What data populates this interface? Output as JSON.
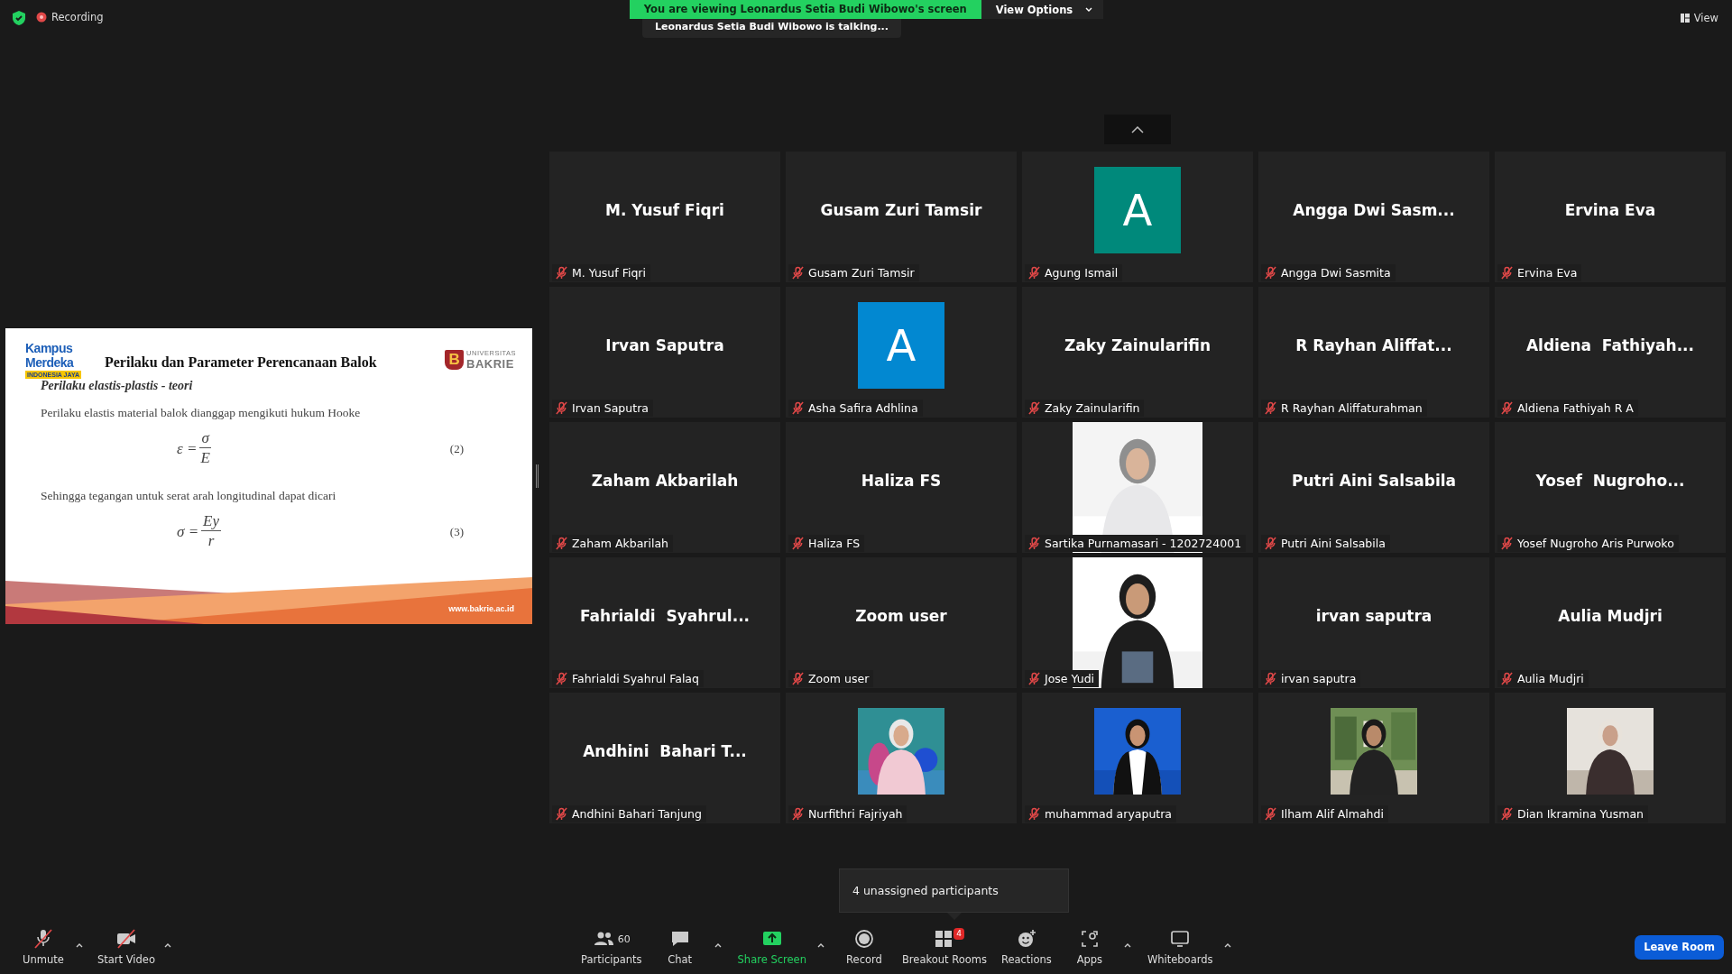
{
  "top_bar": {
    "recording": "Recording",
    "banner": "You are viewing Leonardus Setia Budi Wibowo's screen",
    "view_options": "View Options",
    "talking": "Leonardus Setia Budi Wibowo is talking...",
    "view": "View"
  },
  "slide": {
    "logo_left": {
      "line1": "Kampus",
      "line2": "Merdeka",
      "tag": "INDONESIA JAYA"
    },
    "title": "Perilaku dan Parameter Perencanaan Balok",
    "logo_right": {
      "mark": "B",
      "small": "UNIVERSITAS",
      "name": "BAKRIE"
    },
    "subtitle": "Perilaku elastis-plastis - teori",
    "body": [
      {
        "kind": "paragraph",
        "text": "Perilaku elastis material balok dianggap mengikuti hukum Hooke"
      },
      {
        "kind": "equation",
        "lhs": "ε =",
        "numerator": "σ",
        "denominator": "E",
        "number": "(2)"
      },
      {
        "kind": "paragraph",
        "text": "Sehingga tegangan untuk serat arah longitudinal dapat dicari"
      },
      {
        "kind": "equation",
        "lhs": "σ =",
        "numerator": "Ey",
        "denominator": "r",
        "number": "(3)"
      }
    ],
    "footer": "www.bakrie.ac.id"
  },
  "tiles": [
    {
      "kind": "name",
      "display": "M. Yusuf Fiqri",
      "label": "M. Yusuf Fiqri",
      "muted": true
    },
    {
      "kind": "name",
      "display": "Gusam Zuri Tamsir",
      "label": "Gusam Zuri Tamsir",
      "muted": true
    },
    {
      "kind": "avatar",
      "letter": "A",
      "color": "#00897b",
      "label": "Agung Ismail",
      "muted": true
    },
    {
      "kind": "name",
      "display": "Angga Dwi Sasm...",
      "label": "Angga Dwi Sasmita",
      "muted": true
    },
    {
      "kind": "name",
      "display": "Ervina Eva",
      "label": "Ervina Eva",
      "muted": true
    },
    {
      "kind": "name",
      "display": "Irvan Saputra",
      "label": "Irvan Saputra",
      "muted": true
    },
    {
      "kind": "avatar",
      "letter": "A",
      "color": "#0288d1",
      "label": "Asha Safira Adhlina",
      "muted": true
    },
    {
      "kind": "name",
      "display": "Zaky Zainularifin",
      "label": "Zaky Zainularifin",
      "muted": true
    },
    {
      "kind": "name",
      "display": "R Rayhan Aliffat...",
      "label": "R Rayhan Aliffaturahman",
      "muted": true
    },
    {
      "kind": "name",
      "display": "Aldiena  Fathiyah...",
      "label": "Aldiena Fathiyah R A",
      "muted": true
    },
    {
      "kind": "name",
      "display": "Zaham Akbarilah",
      "label": "Zaham Akbarilah",
      "muted": true
    },
    {
      "kind": "name",
      "display": "Haliza FS",
      "label": "Haliza FS",
      "muted": true
    },
    {
      "kind": "video",
      "label": "Sartika Purnamasari - 1202724001",
      "muted": true
    },
    {
      "kind": "name",
      "display": "Putri Aini Salsabila",
      "label": "Putri Aini Salsabila",
      "muted": true
    },
    {
      "kind": "name",
      "display": "Yosef  Nugroho...",
      "label": "Yosef Nugroho Aris Purwoko",
      "muted": true
    },
    {
      "kind": "name",
      "display": "Fahrialdi  Syahrul...",
      "label": "Fahrialdi Syahrul Falaq",
      "muted": true
    },
    {
      "kind": "name",
      "display": "Zoom user",
      "label": "Zoom user",
      "muted": true
    },
    {
      "kind": "video",
      "label": "Jose Yudi",
      "muted": true
    },
    {
      "kind": "name",
      "display": "irvan saputra",
      "label": "irvan saputra",
      "muted": true
    },
    {
      "kind": "name",
      "display": "Aulia Mudjri",
      "label": "Aulia Mudjri",
      "muted": true
    },
    {
      "kind": "name",
      "display": "Andhini  Bahari T...",
      "label": "Andhini Bahari Tanjung",
      "muted": true
    },
    {
      "label": "Nurfithri Fajriyah",
      "muted": true
    },
    {
      "label": "muhammad aryaputra",
      "muted": true
    },
    {
      "label": "Ilham Alif Almahdi",
      "muted": true
    },
    {
      "label": "Dian Ikramina Yusman",
      "muted": true
    }
  ],
  "tooltip": "4 unassigned participants",
  "toolbar": [
    {
      "label": "Unmute",
      "off": true,
      "caret": true
    },
    {
      "label": "Start Video",
      "off": true,
      "caret": true
    },
    {
      "label": "Participants",
      "count": "60",
      "caret": false
    },
    {
      "label": "Chat",
      "caret": true
    },
    {
      "label": "Share Screen",
      "highlighted": true,
      "caret": true
    },
    {
      "label": "Record",
      "caret": false
    },
    {
      "label": "Breakout Rooms",
      "badge": "4",
      "caret": false
    },
    {
      "label": "Reactions",
      "caret": false
    },
    {
      "label": "Apps",
      "caret": true
    },
    {
      "label": "Whiteboards",
      "caret": true
    }
  ],
  "leave_button": "Leave Room"
}
